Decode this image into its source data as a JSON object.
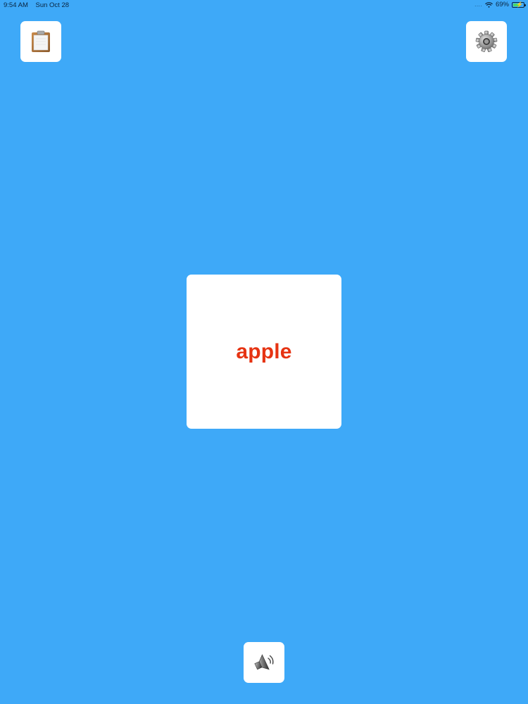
{
  "status_bar": {
    "time": "9:54 AM",
    "date": "Sun Oct 28",
    "signal": "....",
    "battery_percent_label": "69%",
    "battery_level": 0.69,
    "battery_color": "#4cd964"
  },
  "toolbar": {
    "notes_button_icon": "clipboard-icon",
    "settings_button_icon": "gear-icon",
    "sound_button_icon": "speaker-icon"
  },
  "card": {
    "word": "apple",
    "word_color": "#E63312"
  },
  "colors": {
    "background": "#3EA9F8",
    "tile": "#ffffff"
  }
}
